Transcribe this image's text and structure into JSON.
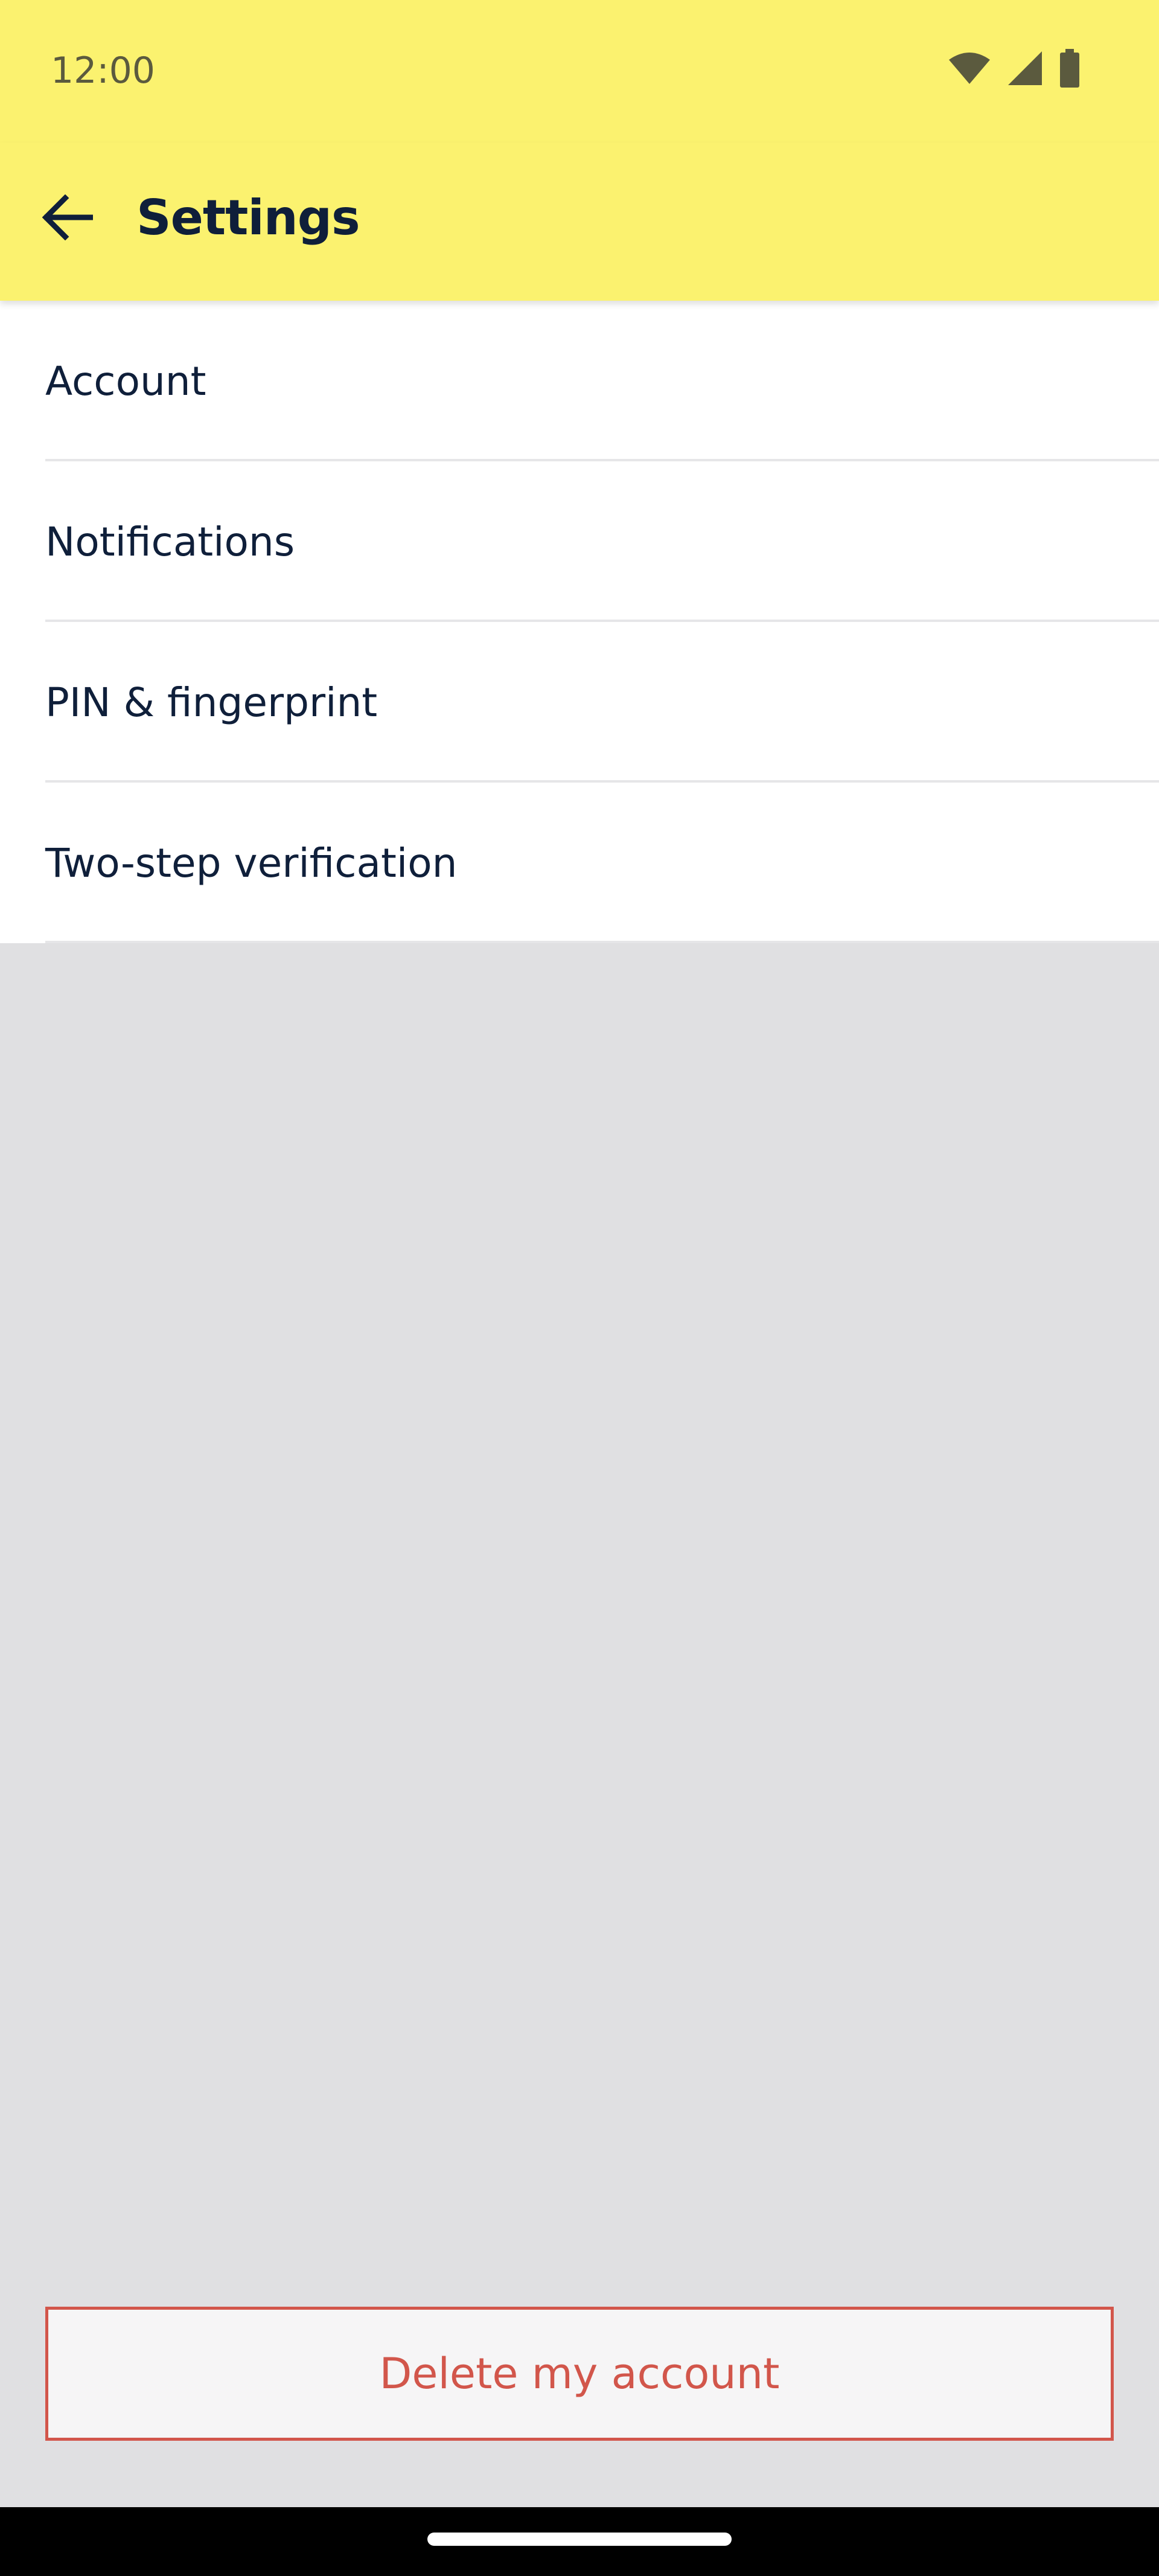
{
  "status_bar": {
    "time": "12:00",
    "icons": [
      "wifi-icon",
      "cellular-signal-icon",
      "battery-icon"
    ]
  },
  "app_bar": {
    "title": "Settings",
    "back_icon": "arrow-left-icon"
  },
  "settings": {
    "items": [
      {
        "label": "Account"
      },
      {
        "label": "Notifications"
      },
      {
        "label": "PIN & fingerprint"
      },
      {
        "label": "Two-step verification"
      }
    ]
  },
  "actions": {
    "delete_label": "Delete my account"
  },
  "colors": {
    "app_bar": "#fbf26f",
    "text_primary": "#0f1f3a",
    "danger": "#d2564b",
    "background": "#e0e0e2"
  }
}
